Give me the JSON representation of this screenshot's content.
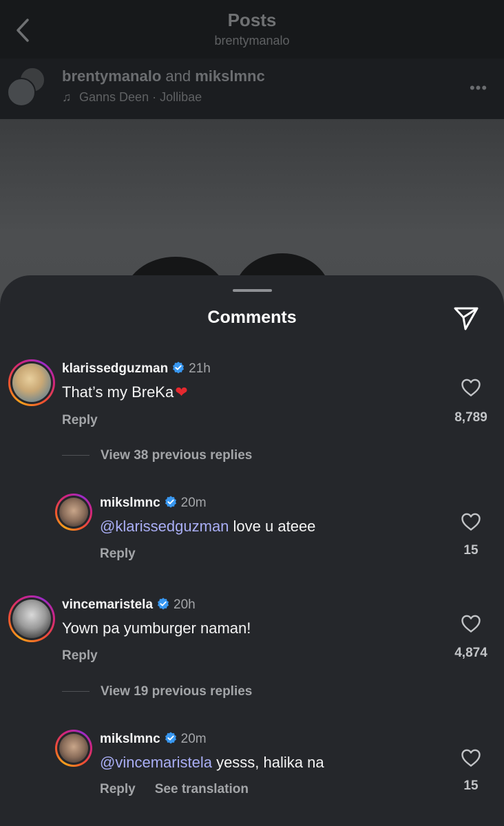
{
  "header": {
    "title": "Posts",
    "subtitle": "brentymanalo"
  },
  "post": {
    "author1": "brentymanalo",
    "joiner": "and",
    "author2": "mikslmnc",
    "audio": "Ganns Deen · Jollibae"
  },
  "sheet": {
    "title": "Comments"
  },
  "comments": [
    {
      "user": "klarissedguzman",
      "time": "21h",
      "text": "That’s my BreKa",
      "emoji": "❤",
      "reply_label": "Reply",
      "likes": "8,789",
      "view_replies": "View 38 previous replies"
    },
    {
      "user": "mikslmnc",
      "time": "20m",
      "mention": "@klarissedguzman",
      "text": "love u ateee",
      "reply_label": "Reply",
      "likes": "15"
    },
    {
      "user": "vincemaristela",
      "time": "20h",
      "text": "Yown pa yumburger naman!",
      "reply_label": "Reply",
      "likes": "4,874",
      "view_replies": "View 19 previous replies"
    },
    {
      "user": "mikslmnc",
      "time": "20m",
      "mention": "@vincemaristela",
      "text": "yesss, halika na",
      "reply_label": "Reply",
      "translate_label": "See translation",
      "likes": "15"
    }
  ],
  "colors": {
    "sheet_bg": "#25272b",
    "mention": "#a9aef5",
    "verified": "#3897f0",
    "heart_emoji": "#e5292f"
  },
  "icons": [
    "back-arrow-icon",
    "music-note-icon",
    "more-options-icon",
    "share-paper-plane-icon",
    "verified-badge-icon",
    "heart-outline-icon"
  ]
}
